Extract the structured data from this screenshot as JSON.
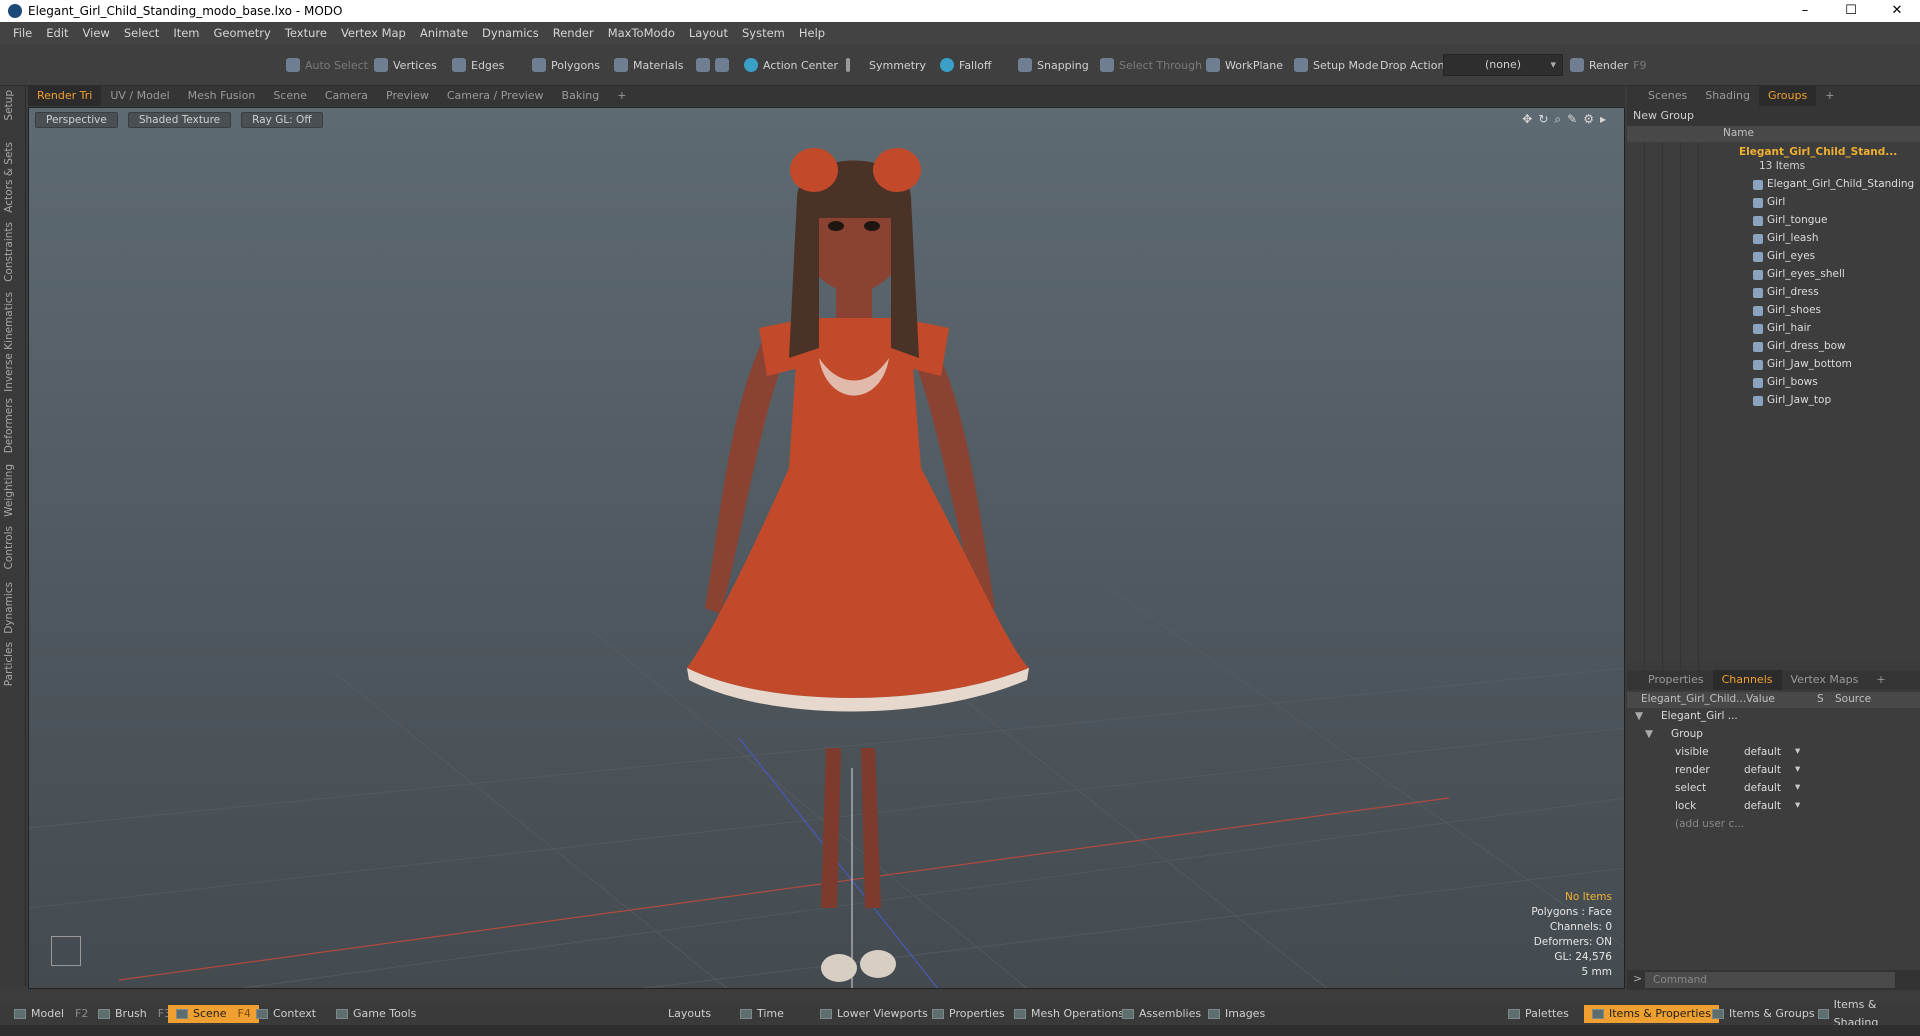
{
  "window": {
    "title": "Elegant_Girl_Child_Standing_modo_base.lxo - MODO",
    "controls": [
      "–",
      "☐",
      "✕"
    ]
  },
  "menu": [
    "File",
    "Edit",
    "View",
    "Select",
    "Item",
    "Geometry",
    "Texture",
    "Vertex Map",
    "Animate",
    "Dynamics",
    "Render",
    "MaxToModo",
    "Layout",
    "System",
    "Help"
  ],
  "toolbar": {
    "auto_select": "Auto Select",
    "vertices": "Vertices",
    "edges": "Edges",
    "polygons": "Polygons",
    "materials": "Materials",
    "action_center": "Action Center",
    "symmetry": "Symmetry",
    "falloff": "Falloff",
    "snapping": "Snapping",
    "select_through": "Select Through",
    "workplane": "WorkPlane",
    "setup_mode": "Setup Mode",
    "drop_action": "Drop Action",
    "drop_action_value": "(none)",
    "render": "Render",
    "render_key": "F9"
  },
  "left_tabs": [
    "Setup",
    "Actors & Sets",
    "Constraints",
    "Inverse Kinematics",
    "Deformers",
    "Weighting",
    "Controls",
    "Dynamics",
    "Particles"
  ],
  "viewport_tabs": [
    "Render Tri",
    "UV / Model",
    "Mesh Fusion",
    "Scene",
    "Camera",
    "Preview",
    "Camera / Preview",
    "Baking",
    "+"
  ],
  "viewport": {
    "view": "Perspective",
    "shading": "Shaded Texture",
    "raygl": "Ray GL: Off",
    "info": {
      "items": "No Items",
      "polygons": "Polygons : Face",
      "channels": "Channels: 0",
      "deformers": "Deformers: ON",
      "gl": "GL: 24,576",
      "unit": "5 mm"
    }
  },
  "right_top_tabs": [
    "Scenes",
    "Shading",
    "Groups",
    "+"
  ],
  "groups": {
    "new_group": "New Group",
    "name_header": "Name",
    "root": "Elegant_Girl_Child_Stand...",
    "root_count": "13 Items",
    "items": [
      "Elegant_Girl_Child_Standing",
      "Girl",
      "Girl_tongue",
      "Girl_leash",
      "Girl_eyes",
      "Girl_eyes_shell",
      "Girl_dress",
      "Girl_shoes",
      "Girl_hair",
      "Girl_dress_bow",
      "Girl_Jaw_bottom",
      "Girl_bows",
      "Girl_Jaw_top"
    ]
  },
  "right_bottom_tabs": [
    "Properties",
    "Channels",
    "Vertex Maps",
    "+"
  ],
  "channels": {
    "col_name": "Elegant_Girl_Child...",
    "col_value": "Value",
    "col_s": "S",
    "col_source": "Source",
    "item": "Elegant_Girl ...",
    "group": "Group",
    "rows": [
      {
        "name": "visible",
        "value": "default"
      },
      {
        "name": "render",
        "value": "default"
      },
      {
        "name": "select",
        "value": "default"
      },
      {
        "name": "lock",
        "value": "default"
      }
    ],
    "add_user": "(add user c..."
  },
  "command": {
    "placeholder": "Command"
  },
  "bottom": {
    "model": "Model",
    "model_key": "F2",
    "brush": "Brush",
    "brush_key": "F3",
    "scene": "Scene",
    "scene_key": "F4",
    "context": "Context",
    "game_tools": "Game Tools",
    "layouts": "Layouts",
    "time": "Time",
    "lower_viewports": "Lower Viewports",
    "properties": "Properties",
    "mesh_operations": "Mesh Operations",
    "assemblies": "Assemblies",
    "images": "Images",
    "palettes": "Palettes",
    "items_properties": "Items & Properties",
    "items_groups": "Items & Groups",
    "items_shading": "Items & Shading"
  },
  "colors": {
    "accent": "#f0a030",
    "dress": "#c24a2a",
    "skin": "#8a4232",
    "hair": "#4a3226"
  }
}
